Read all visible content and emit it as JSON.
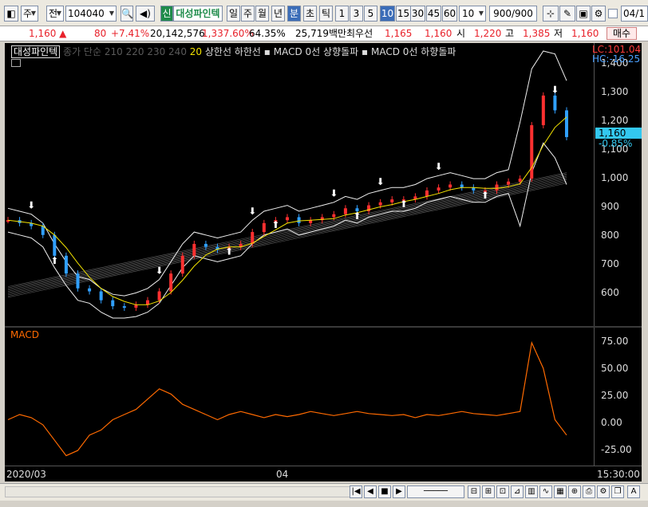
{
  "toolbar": {
    "market_label": "주",
    "ref_label": "전",
    "code": "104040",
    "shin_label": "신",
    "stock_name": "대성파인텍",
    "period_tabs": [
      "일",
      "주",
      "월",
      "년",
      "분",
      "초",
      "틱"
    ],
    "intervals": [
      "1",
      "3",
      "5",
      "10",
      "15",
      "30",
      "45",
      "60"
    ],
    "active_interval": "10",
    "interval_value": "10",
    "count_display": "900/900",
    "date_field": "04/1"
  },
  "info": {
    "price": "1,160",
    "change": "80",
    "change_pct": "+7.41%",
    "volume": "20,142,576",
    "volume_pct": "1,337.60%",
    "turnover": "64.35%",
    "amount": "25,719백만",
    "best_ask_label": "최우선",
    "best_ask": "1,165",
    "best_bid": "1,160",
    "open_label": "시",
    "open": "1,220",
    "high_label": "고",
    "high": "1,385",
    "low_label": "저",
    "low": "1,160",
    "trade_button": "매수"
  },
  "legend": {
    "selected": "대성파인텍",
    "ma_label": "종가 단순",
    "ma_periods": [
      "210",
      "220",
      "230",
      "240"
    ],
    "twenty": "20",
    "upper": "상한선",
    "lower": "하한선",
    "macd_up": "MACD 0선 상향돌파",
    "macd_down": "MACD 0선 하향돌파"
  },
  "price_axis": {
    "lc_label": "LC:101.04",
    "hc_label": "HC:-16.25",
    "current_tag": "1,160",
    "current_pct": "-0.85%",
    "ticks": [
      "1,400",
      "1,300",
      "1,200",
      "1,100",
      "1,000",
      "900",
      "800",
      "700",
      "600"
    ]
  },
  "macd_pane": {
    "title": "MACD",
    "ticks": [
      "75.00",
      "50.00",
      "25.00",
      "0.00",
      "-25.00"
    ]
  },
  "x_axis": {
    "labels": [
      "2020/03",
      "04"
    ],
    "time": "15:30:00"
  },
  "chart_data": [
    {
      "type": "line",
      "title": "",
      "series": [
        {
          "name": "대성파인텍",
          "values": [
            880,
            870,
            860,
            830,
            760,
            700,
            650,
            640,
            610,
            590,
            585,
            595,
            610,
            640,
            700,
            760,
            800,
            790,
            780,
            790,
            800,
            840,
            870,
            880,
            890,
            870,
            880,
            890,
            900,
            920,
            910,
            930,
            940,
            950,
            950,
            960,
            980,
            990,
            1000,
            990,
            980,
            980,
            1000,
            1010,
            1020,
            1200,
            1300,
            1250,
            1160
          ]
        }
      ],
      "ylim": [
        550,
        1450
      ]
    },
    {
      "type": "line",
      "title": "MACD",
      "series": [
        {
          "name": "MACD",
          "values": [
            0,
            5,
            2,
            -5,
            -20,
            -35,
            -30,
            -15,
            -10,
            0,
            5,
            10,
            20,
            30,
            25,
            15,
            10,
            5,
            0,
            5,
            8,
            5,
            2,
            5,
            3,
            5,
            8,
            6,
            4,
            6,
            8,
            6,
            5,
            4,
            5,
            2,
            5,
            4,
            6,
            8,
            6,
            5,
            4,
            6,
            8,
            75,
            50,
            0,
            -15
          ]
        }
      ],
      "ylim": [
        -40,
        85
      ]
    }
  ]
}
